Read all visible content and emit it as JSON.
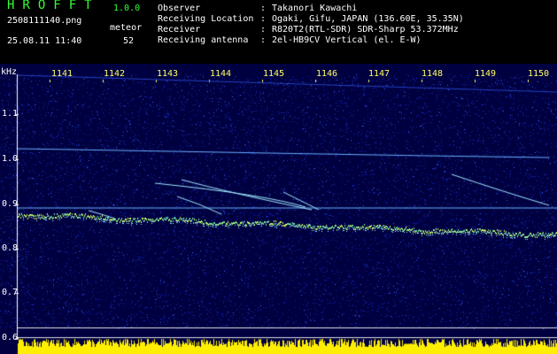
{
  "header": {
    "title": "HROFFT",
    "version": "1.0.0",
    "filename": "2508111140.png",
    "meteor_label": "meteor",
    "datetime": "25.08.11 11:40",
    "meteor_count": "52"
  },
  "info": [
    {
      "label": "Observer",
      "value": "Takanori Kawachi"
    },
    {
      "label": "Receiving Location",
      "value": "Ogaki, Gifu, JAPAN (136.60E, 35.35N)"
    },
    {
      "label": "Receiver",
      "value": "R820T2(RTL-SDR) SDR-Sharp 53.372MHz"
    },
    {
      "label": "Receiving antenna",
      "value": "2el-HB9CV Vertical (el. E-W)"
    }
  ],
  "plot": {
    "y_unit": "kHz",
    "y_ticks": [
      "1.1",
      "1.0",
      "0.9",
      "0.8",
      "0.7",
      "0.6"
    ],
    "x_ticks": [
      "1141",
      "1142",
      "1143",
      "1144",
      "1145",
      "1146",
      "1147",
      "1148",
      "1149",
      "1150"
    ],
    "colors": {
      "background": "#000040",
      "noise": "#1a2fd0",
      "carrier": "#6ab0ff",
      "echo": "#9fe8ff",
      "level": "#ffee00"
    }
  }
}
